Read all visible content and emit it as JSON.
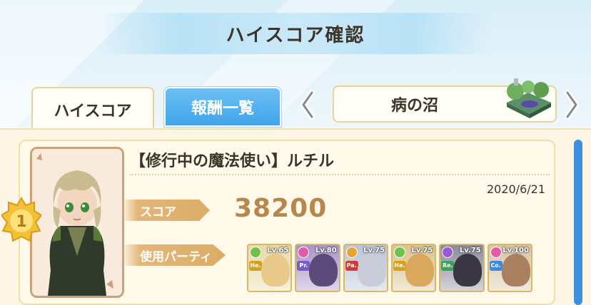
{
  "header": {
    "title": "ハイスコア確認"
  },
  "tabs": {
    "highscore_label": "ハイスコア",
    "rewards_label": "報酬一覧"
  },
  "stage": {
    "name": "病の沼"
  },
  "record": {
    "character_name": "【修行中の魔法使い】ルチル",
    "date": "2020/6/21",
    "score_label": "スコア",
    "score_value": "38200",
    "party_label": "使用パーティ",
    "rank": "1"
  },
  "party": [
    {
      "level": "Lv.65",
      "role": "He.",
      "attr_color": "#6cc24a",
      "role_color": "#d8a020",
      "card_color": "#e8d9a8",
      "face_color": "#e8c98a"
    },
    {
      "level": "Lv.80",
      "role": "Pr.",
      "attr_color": "#e25aa8",
      "role_color": "#7a5cc8",
      "card_color": "#a893c9",
      "face_color": "#5b4a7a"
    },
    {
      "level": "Lv.75",
      "role": "Pa.",
      "attr_color": "#e8a23a",
      "role_color": "#d23a3a",
      "card_color": "#b8c3d6",
      "face_color": "#c9ccd8"
    },
    {
      "level": "Lv.75",
      "role": "He.",
      "attr_color": "#6cc24a",
      "role_color": "#d8a020",
      "card_color": "#d9c38e",
      "face_color": "#d9a85c"
    },
    {
      "level": "Lv.75",
      "role": "Re.",
      "attr_color": "#9a5ad8",
      "role_color": "#3aa25a",
      "card_color": "#8c8a9a",
      "face_color": "#3a3642"
    },
    {
      "level": "Lv.100",
      "role": "Co.",
      "attr_color": "#e25aa8",
      "role_color": "#3a8ae0",
      "card_color": "#d8c4a6",
      "face_color": "#a98060"
    }
  ]
}
